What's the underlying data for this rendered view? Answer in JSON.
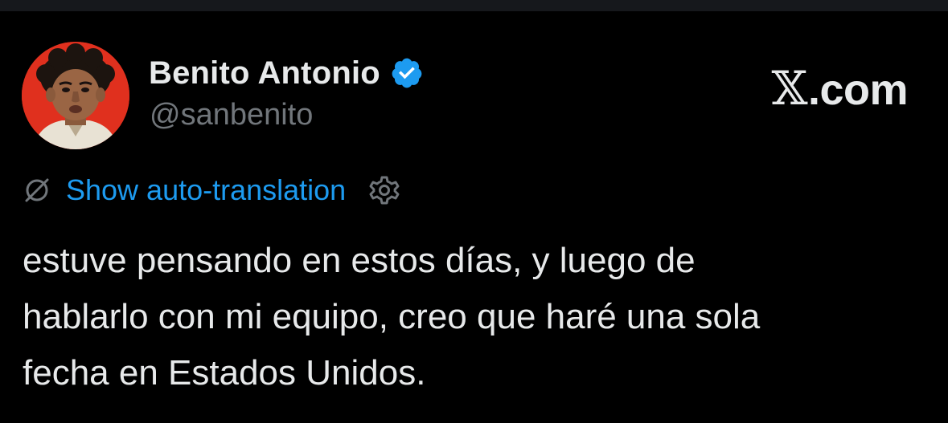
{
  "author": {
    "display_name": "Benito Antonio",
    "handle": "@sanbenito",
    "verified": true,
    "avatar_icon": "profile-photo",
    "avatar_bg": "#e0301e"
  },
  "brand": {
    "glyph": "𝕏",
    "suffix": ".com"
  },
  "translation": {
    "link_label": "Show auto-translation",
    "status_icon": "no-translate-icon",
    "settings_icon": "gear-icon"
  },
  "tweet": {
    "lines": [
      "estuve pensando en estos días, y luego de",
      "hablarlo con mi equipo, creo que haré una sola",
      "fecha en Estados Unidos."
    ]
  },
  "colors": {
    "background": "#000000",
    "text_primary": "#e7e9ea",
    "text_secondary": "#71767b",
    "link": "#1d9bf0",
    "verified_badge": "#1d9bf0"
  }
}
